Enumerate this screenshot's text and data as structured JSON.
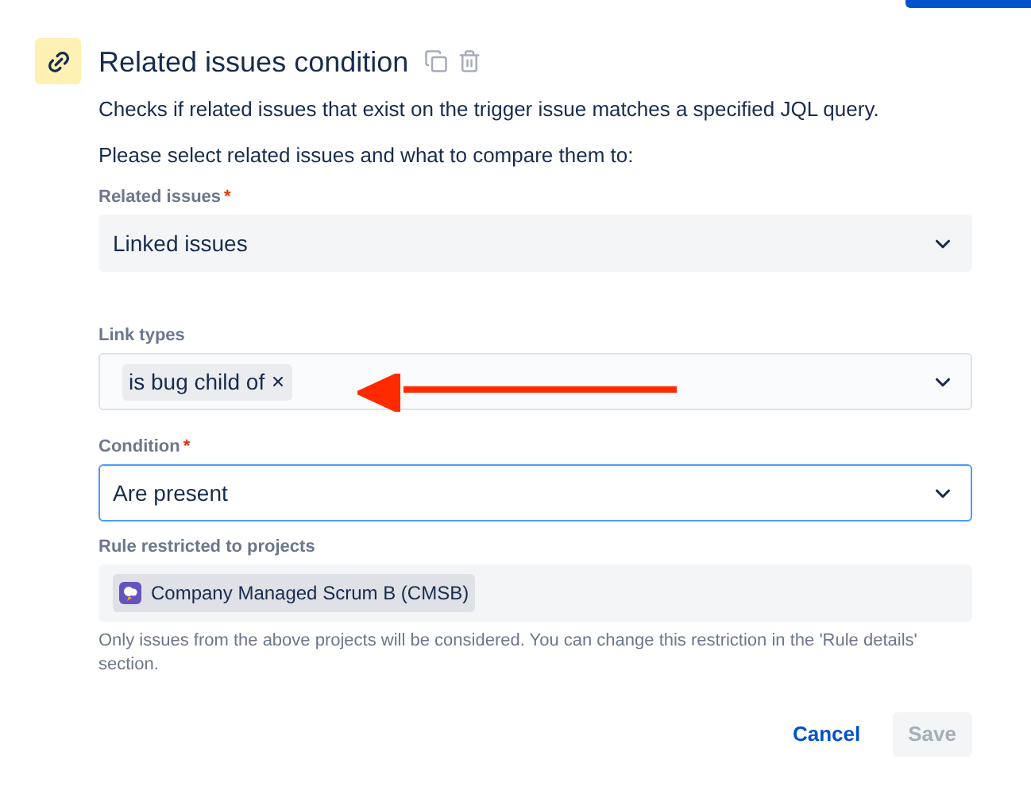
{
  "title": "Related issues condition",
  "description": "Checks if related issues that exist on the trigger issue matches a specified JQL query.",
  "prompt": "Please select related issues and what to compare them to:",
  "fields": [
    {
      "kind": "select",
      "label": "Related issues",
      "required_mark": "*",
      "focused": false,
      "value": "Linked issues"
    },
    {
      "kind": "tags",
      "label": "Link types",
      "focused": false,
      "tags": [
        "is bug child of"
      ]
    },
    {
      "kind": "select",
      "label": "Condition",
      "required_mark": "*",
      "focused": true,
      "value": "Are present"
    },
    {
      "kind": "projects",
      "label": "Rule restricted to projects",
      "focused": false,
      "tags": [
        "Company Managed Scrum B (CMSB)"
      ]
    }
  ],
  "help_text": "Only issues from the above projects will be considered. You can change this restriction in the 'Rule details' section.",
  "buttons": [
    {
      "label": "Cancel",
      "disabled": false
    },
    {
      "label": "Save",
      "disabled": true
    }
  ]
}
